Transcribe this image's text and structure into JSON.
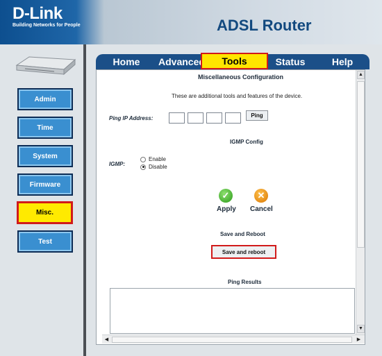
{
  "header": {
    "brand": "D-Link",
    "tagline": "Building Networks for People",
    "product": "ADSL Router"
  },
  "sidebar": {
    "items": [
      {
        "label": "Admin",
        "icon": "button"
      },
      {
        "label": "Time",
        "icon": "button"
      },
      {
        "label": "System",
        "icon": "button"
      },
      {
        "label": "Firmware",
        "icon": "button"
      },
      {
        "label": "Misc.",
        "icon": "button",
        "active": true
      },
      {
        "label": "Test",
        "icon": "button"
      }
    ]
  },
  "tabs": [
    {
      "label": "Home"
    },
    {
      "label": "Advanced"
    },
    {
      "label": "Tools",
      "active": true
    },
    {
      "label": "Status"
    },
    {
      "label": "Help"
    }
  ],
  "main": {
    "title": "Miscellaneous Configuration",
    "description": "These are additional tools and features of the device.",
    "ping": {
      "label": "Ping IP Address:",
      "button": "Ping",
      "octets": [
        "",
        "",
        "",
        ""
      ]
    },
    "igmp": {
      "section_title": "IGMP Config",
      "label": "IGMP:",
      "options": [
        {
          "label": "Enable",
          "checked": false
        },
        {
          "label": "Disable",
          "checked": true
        }
      ]
    },
    "actions": {
      "apply": "Apply",
      "cancel": "Cancel"
    },
    "save_reboot": {
      "section_title": "Save and Reboot",
      "button": "Save and reboot"
    },
    "ping_results": {
      "title": "Ping Results",
      "text": ""
    }
  },
  "colors": {
    "highlight_yellow": "#ffea00",
    "highlight_red": "#d11a1a",
    "nav_blue": "#3a8fd0",
    "tab_navy": "#1b4f88"
  }
}
